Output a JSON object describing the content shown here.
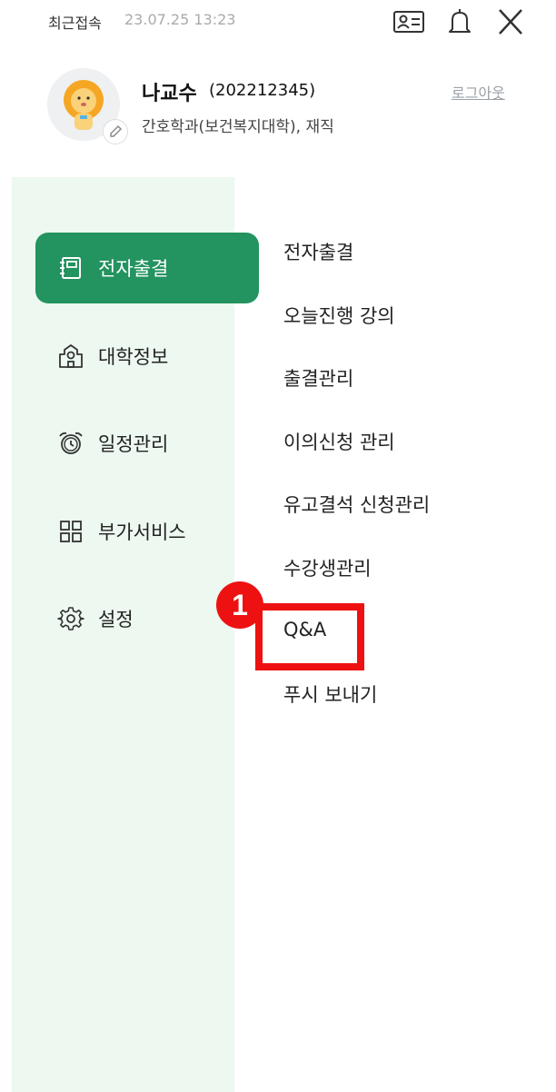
{
  "header": {
    "last_access_label": "최근접속",
    "last_access_time": "23.07.25 13:23",
    "icons": [
      "id-card-icon",
      "bell-icon",
      "close-icon"
    ]
  },
  "profile": {
    "name": "나교수",
    "id": "(202212345)",
    "department": "간호학과(보건복지대학), 재직",
    "logout_label": "로그아웃"
  },
  "sidebar": {
    "items": [
      {
        "label": "전자출결",
        "icon": "notebook-icon",
        "active": true
      },
      {
        "label": "대학정보",
        "icon": "university-icon",
        "active": false
      },
      {
        "label": "일정관리",
        "icon": "alarm-clock-icon",
        "active": false
      },
      {
        "label": "부가서비스",
        "icon": "grid-icon",
        "active": false
      },
      {
        "label": "설정",
        "icon": "gear-icon",
        "active": false
      }
    ]
  },
  "submenu": {
    "items": [
      {
        "label": "전자출결"
      },
      {
        "label": "오늘진행 강의"
      },
      {
        "label": "출결관리"
      },
      {
        "label": "이의신청 관리"
      },
      {
        "label": "유고결석 신청관리"
      },
      {
        "label": "수강생관리"
      },
      {
        "label": "Q&A"
      },
      {
        "label": "푸시 보내기"
      }
    ]
  },
  "annotation": {
    "step_number": "1"
  },
  "colors": {
    "accent": "#23935f",
    "sidebar_bg": "#ecf8f0",
    "highlight": "#ee1111"
  }
}
